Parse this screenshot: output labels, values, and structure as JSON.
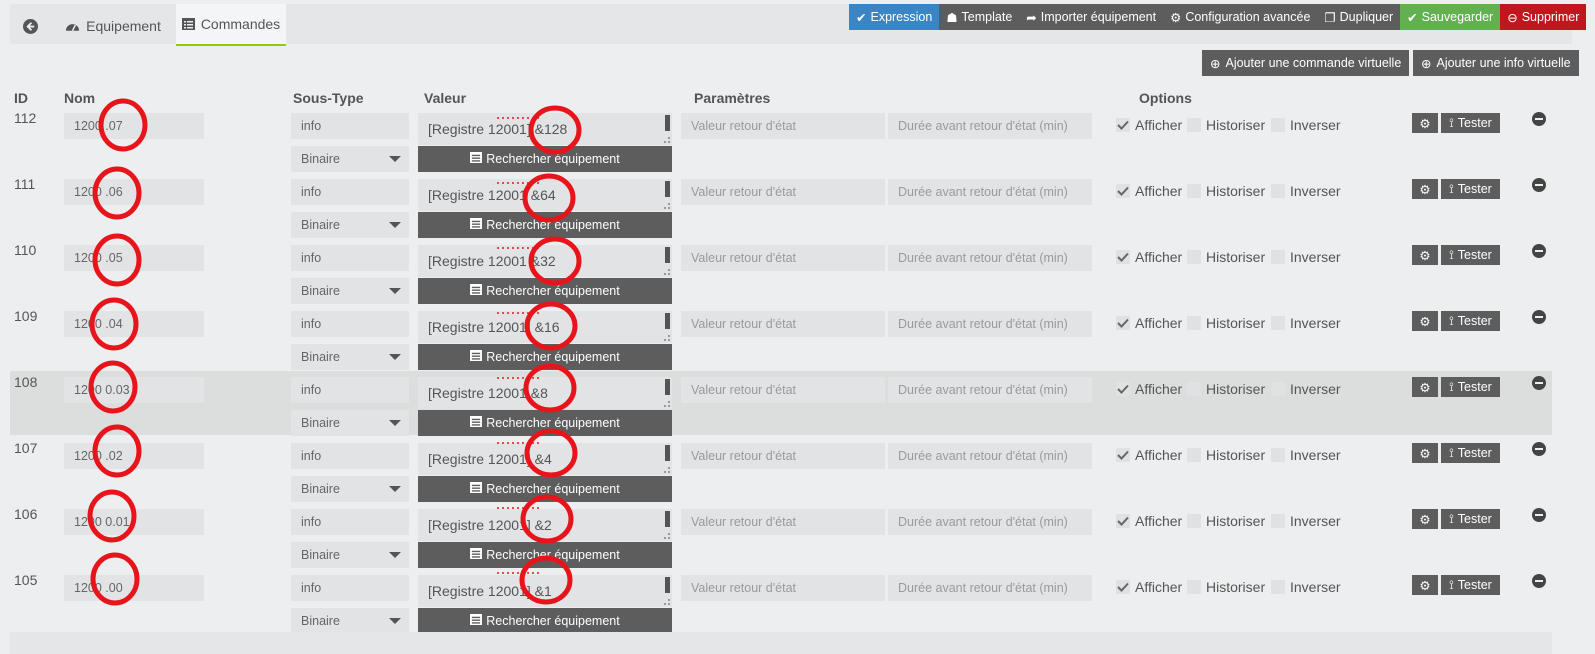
{
  "tabs": {
    "back_label": "",
    "equipement_label": "Equipement",
    "commandes_label": "Commandes"
  },
  "toolbar": {
    "expression": "Expression",
    "template": "Template",
    "importer": "Importer équipement",
    "config": "Configuration avancée",
    "dupliquer": "Dupliquer",
    "sauvegarder": "Sauvegarder",
    "supprimer": "Supprimer"
  },
  "actions": {
    "add_command": "Ajouter une commande virtuelle",
    "add_info": "Ajouter une info virtuelle"
  },
  "headers": {
    "id": "ID",
    "nom": "Nom",
    "soustype": "Sous-Type",
    "valeur": "Valeur",
    "parametres": "Paramètres",
    "options": "Options"
  },
  "labels": {
    "type": "info",
    "subtype": "Binaire",
    "search": "Rechercher équipement",
    "retour_placeholder": "Valeur retour d'état",
    "duree_placeholder": "Durée avant retour d'état (min)",
    "afficher": "Afficher",
    "historiser": "Historiser",
    "inverser": "Inverser",
    "tester": "Tester"
  },
  "rows": [
    {
      "id": "112",
      "name": "1200 .07",
      "value": "[Registre 12001] &128"
    },
    {
      "id": "111",
      "name": "1200 .06",
      "value": "[Registre 12001 &64"
    },
    {
      "id": "110",
      "name": "1200 .05",
      "value": "[Registre 12001 &32"
    },
    {
      "id": "109",
      "name": "1200 .04",
      "value": "[Registre 12001] &16"
    },
    {
      "id": "108",
      "name": "1200 0.03",
      "value": "[Registre 12001 &8"
    },
    {
      "id": "107",
      "name": "1200 .02",
      "value": "[Registre 12001] &4"
    },
    {
      "id": "106",
      "name": "1200 0.01",
      "value": "[Registre 12001] &2"
    },
    {
      "id": "105",
      "name": "1200 .00",
      "value": "[Registre 12001] &1"
    }
  ],
  "colors": {
    "expression": "#3b85c5",
    "save": "#62b151",
    "delete": "#c0171f",
    "dark_button": "#5d5d5d",
    "active_tab_underline": "#94ca02",
    "annotation": "#e8141c"
  }
}
